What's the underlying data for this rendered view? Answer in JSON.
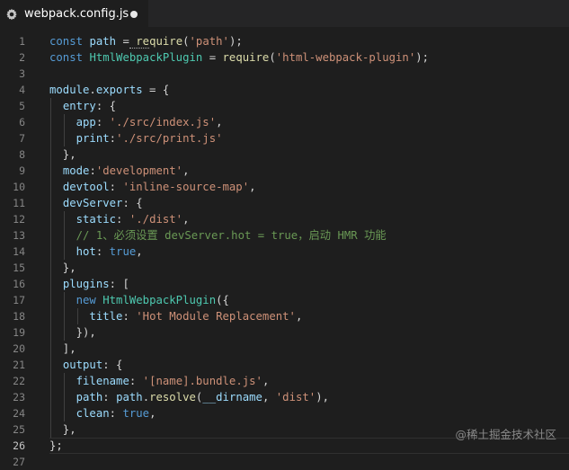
{
  "tab": {
    "filename": "webpack.config.js",
    "icon": "gear-icon",
    "unsaved_indicator": "dot"
  },
  "editor": {
    "active_line": 26,
    "lines": [
      {
        "number": "1",
        "tokens": [
          [
            "kw",
            "const"
          ],
          [
            "p",
            " "
          ],
          [
            "var",
            "path"
          ],
          [
            "p",
            " = "
          ],
          [
            "fn",
            "require"
          ],
          [
            "p",
            "("
          ],
          [
            "str",
            "'path'"
          ],
          [
            "p",
            ");"
          ]
        ]
      },
      {
        "number": "2",
        "tokens": [
          [
            "kw",
            "const"
          ],
          [
            "p",
            " "
          ],
          [
            "cls",
            "HtmlWebpackPlugin"
          ],
          [
            "p",
            " = "
          ],
          [
            "fn",
            "require"
          ],
          [
            "p",
            "("
          ],
          [
            "str",
            "'html-webpack-plugin'"
          ],
          [
            "p",
            ");"
          ]
        ]
      },
      {
        "number": "3",
        "tokens": []
      },
      {
        "number": "4",
        "tokens": [
          [
            "var",
            "module"
          ],
          [
            "p",
            "."
          ],
          [
            "var",
            "exports"
          ],
          [
            "p",
            " = {"
          ]
        ]
      },
      {
        "number": "5",
        "tokens": [
          [
            "p",
            "  "
          ],
          [
            "var",
            "entry"
          ],
          [
            "p",
            ": {"
          ]
        ]
      },
      {
        "number": "6",
        "tokens": [
          [
            "p",
            "    "
          ],
          [
            "var",
            "app"
          ],
          [
            "p",
            ": "
          ],
          [
            "str",
            "'./src/index.js'"
          ],
          [
            "p",
            ","
          ]
        ]
      },
      {
        "number": "7",
        "tokens": [
          [
            "p",
            "    "
          ],
          [
            "var",
            "print"
          ],
          [
            "p",
            ":"
          ],
          [
            "str",
            "'./src/print.js'"
          ]
        ]
      },
      {
        "number": "8",
        "tokens": [
          [
            "p",
            "  },"
          ]
        ]
      },
      {
        "number": "9",
        "tokens": [
          [
            "p",
            "  "
          ],
          [
            "var",
            "mode"
          ],
          [
            "p",
            ":"
          ],
          [
            "str",
            "'development'"
          ],
          [
            "p",
            ","
          ]
        ]
      },
      {
        "number": "10",
        "tokens": [
          [
            "p",
            "  "
          ],
          [
            "var",
            "devtool"
          ],
          [
            "p",
            ": "
          ],
          [
            "str",
            "'inline-source-map'"
          ],
          [
            "p",
            ","
          ]
        ]
      },
      {
        "number": "11",
        "tokens": [
          [
            "p",
            "  "
          ],
          [
            "var",
            "devServer"
          ],
          [
            "p",
            ": {"
          ]
        ]
      },
      {
        "number": "12",
        "tokens": [
          [
            "p",
            "    "
          ],
          [
            "var",
            "static"
          ],
          [
            "p",
            ": "
          ],
          [
            "str",
            "'./dist'"
          ],
          [
            "p",
            ","
          ]
        ]
      },
      {
        "number": "13",
        "tokens": [
          [
            "p",
            "    "
          ],
          [
            "cm",
            "// 1、必须设置 devServer.hot = true，启动 HMR 功能"
          ]
        ]
      },
      {
        "number": "14",
        "tokens": [
          [
            "p",
            "    "
          ],
          [
            "var",
            "hot"
          ],
          [
            "p",
            ": "
          ],
          [
            "kw",
            "true"
          ],
          [
            "p",
            ","
          ]
        ]
      },
      {
        "number": "15",
        "tokens": [
          [
            "p",
            "  },"
          ]
        ]
      },
      {
        "number": "16",
        "tokens": [
          [
            "p",
            "  "
          ],
          [
            "var",
            "plugins"
          ],
          [
            "p",
            ": ["
          ]
        ]
      },
      {
        "number": "17",
        "tokens": [
          [
            "p",
            "    "
          ],
          [
            "kw",
            "new"
          ],
          [
            "p",
            " "
          ],
          [
            "cls",
            "HtmlWebpackPlugin"
          ],
          [
            "p",
            "({"
          ]
        ]
      },
      {
        "number": "18",
        "tokens": [
          [
            "p",
            "      "
          ],
          [
            "var",
            "title"
          ],
          [
            "p",
            ": "
          ],
          [
            "str",
            "'Hot Module Replacement'"
          ],
          [
            "p",
            ","
          ]
        ]
      },
      {
        "number": "19",
        "tokens": [
          [
            "p",
            "    }),"
          ]
        ]
      },
      {
        "number": "20",
        "tokens": [
          [
            "p",
            "  ],"
          ]
        ]
      },
      {
        "number": "21",
        "tokens": [
          [
            "p",
            "  "
          ],
          [
            "var",
            "output"
          ],
          [
            "p",
            ": {"
          ]
        ]
      },
      {
        "number": "22",
        "tokens": [
          [
            "p",
            "    "
          ],
          [
            "var",
            "filename"
          ],
          [
            "p",
            ": "
          ],
          [
            "str",
            "'[name].bundle.js'"
          ],
          [
            "p",
            ","
          ]
        ]
      },
      {
        "number": "23",
        "tokens": [
          [
            "p",
            "    "
          ],
          [
            "var",
            "path"
          ],
          [
            "p",
            ": "
          ],
          [
            "var",
            "path"
          ],
          [
            "p",
            "."
          ],
          [
            "fn",
            "resolve"
          ],
          [
            "p",
            "("
          ],
          [
            "var",
            "__dirname"
          ],
          [
            "p",
            ", "
          ],
          [
            "str",
            "'dist'"
          ],
          [
            "p",
            "),"
          ]
        ]
      },
      {
        "number": "24",
        "tokens": [
          [
            "p",
            "    "
          ],
          [
            "var",
            "clean"
          ],
          [
            "p",
            ": "
          ],
          [
            "kw",
            "true"
          ],
          [
            "p",
            ","
          ]
        ]
      },
      {
        "number": "25",
        "tokens": [
          [
            "p",
            "  },"
          ]
        ]
      },
      {
        "number": "26",
        "tokens": [
          [
            "p",
            "};"
          ]
        ]
      },
      {
        "number": "27",
        "tokens": []
      }
    ]
  },
  "watermark": "@稀土掘金技术社区"
}
